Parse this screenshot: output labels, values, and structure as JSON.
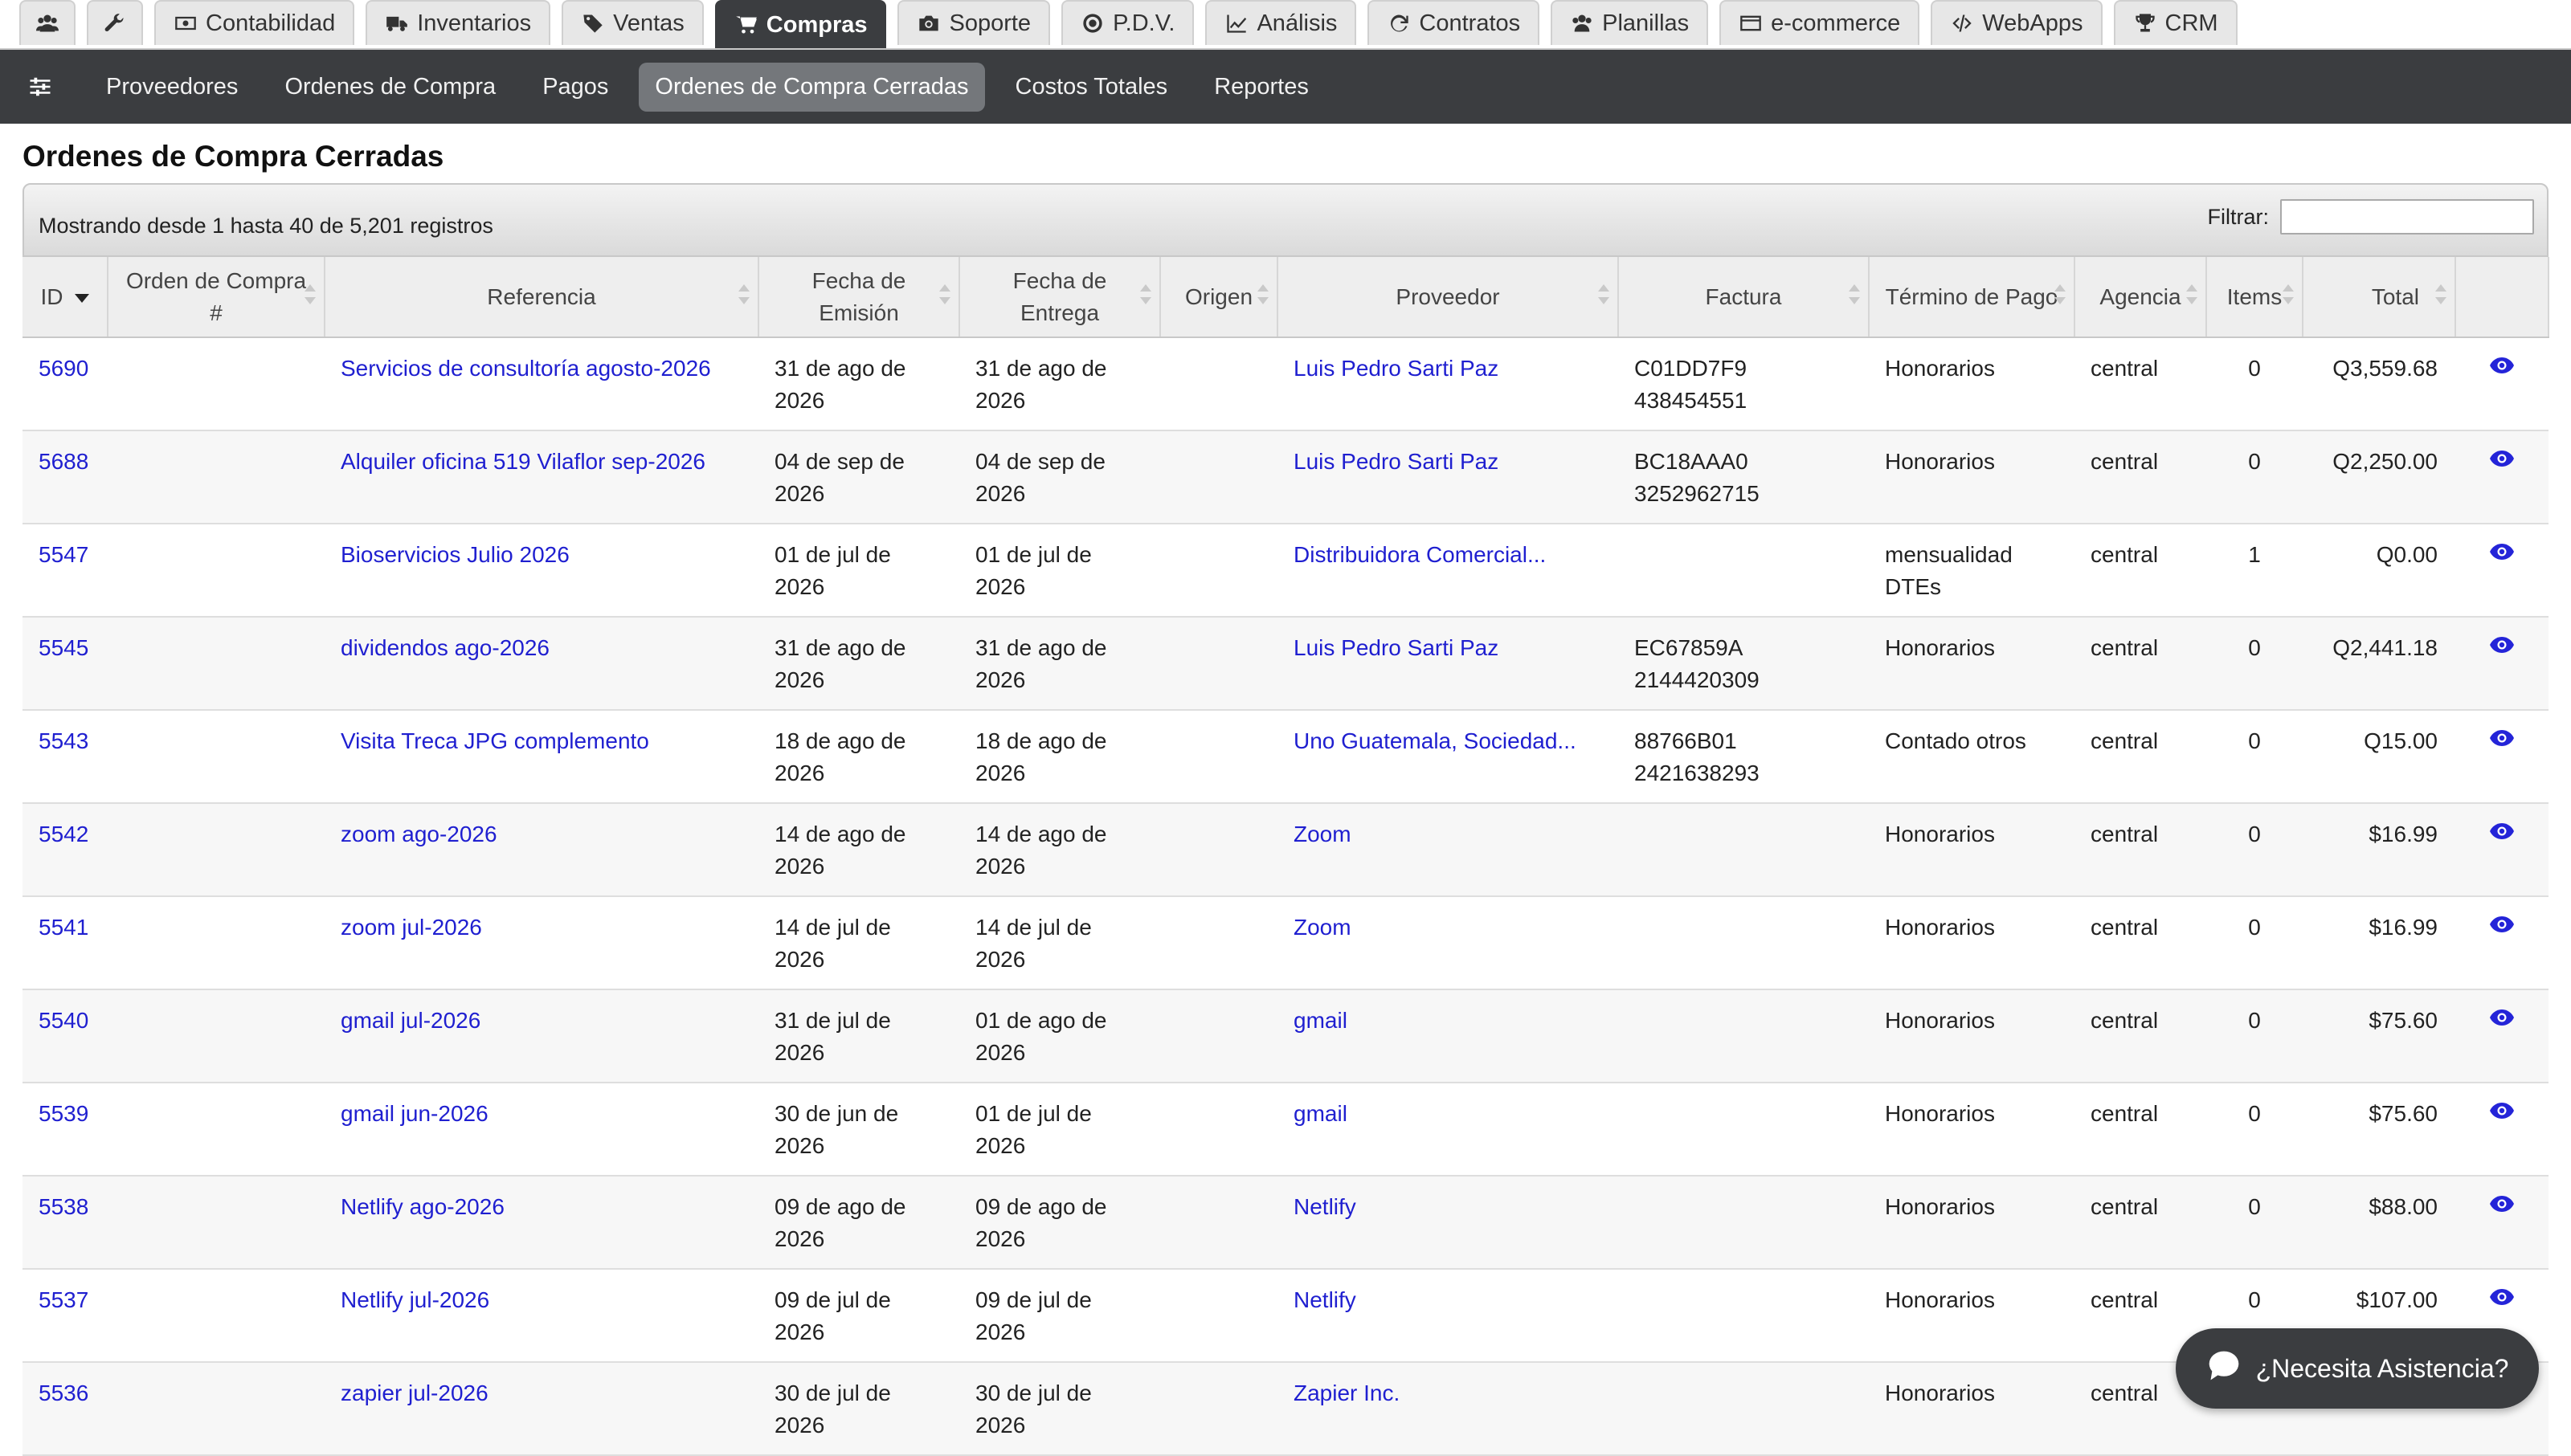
{
  "modules": [
    {
      "label": "",
      "icon": "users-icon"
    },
    {
      "label": "",
      "icon": "wrench-icon"
    },
    {
      "label": "Contabilidad",
      "icon": "money-icon"
    },
    {
      "label": "Inventarios",
      "icon": "truck-icon"
    },
    {
      "label": "Ventas",
      "icon": "tag-icon"
    },
    {
      "label": "Compras",
      "icon": "cart-icon",
      "active": true
    },
    {
      "label": "Soporte",
      "icon": "camera-icon"
    },
    {
      "label": "P.D.V.",
      "icon": "target-icon"
    },
    {
      "label": "Análisis",
      "icon": "chart-icon"
    },
    {
      "label": "Contratos",
      "icon": "refresh-icon"
    },
    {
      "label": "Planillas",
      "icon": "group-icon"
    },
    {
      "label": "e-commerce",
      "icon": "card-icon"
    },
    {
      "label": "WebApps",
      "icon": "code-icon"
    },
    {
      "label": "CRM",
      "icon": "trophy-icon"
    }
  ],
  "subnav": {
    "items": [
      "Proveedores",
      "Ordenes de Compra",
      "Pagos",
      "Ordenes de Compra Cerradas",
      "Costos Totales",
      "Reportes"
    ],
    "active_index": 3
  },
  "page": {
    "title": "Ordenes de Compra Cerradas"
  },
  "table_info": {
    "showing": "Mostrando desde 1 hasta 40 de 5,201 registros",
    "filter_label": "Filtrar:",
    "filter_value": ""
  },
  "columns": {
    "id": "ID",
    "orden": "Orden de Compra #",
    "referencia": "Referencia",
    "emision": "Fecha de Emisión",
    "entrega": "Fecha de Entrega",
    "origen": "Origen",
    "proveedor": "Proveedor",
    "factura": "Factura",
    "termino": "Término de Pago",
    "agencia": "Agencia",
    "items": "Items",
    "total": "Total"
  },
  "rows": [
    {
      "id": "5690",
      "orden": "",
      "referencia": "Servicios de consultoría agosto-2026",
      "emision": "31 de ago de 2026",
      "entrega": "31 de ago de 2026",
      "origen": "",
      "proveedor": "Luis Pedro Sarti Paz",
      "factura": "C01DD7F9 438454551",
      "termino": "Honorarios",
      "agencia": "central",
      "items": "0",
      "total": "Q3,559.68"
    },
    {
      "id": "5688",
      "orden": "",
      "referencia": "Alquiler oficina 519 Vilaflor sep-2026",
      "emision": "04 de sep de 2026",
      "entrega": "04 de sep de 2026",
      "origen": "",
      "proveedor": "Luis Pedro Sarti Paz",
      "factura": "BC18AAA0 3252962715",
      "termino": "Honorarios",
      "agencia": "central",
      "items": "0",
      "total": "Q2,250.00"
    },
    {
      "id": "5547",
      "orden": "",
      "referencia": "Bioservicios Julio 2026",
      "emision": "01 de jul de 2026",
      "entrega": "01 de jul de 2026",
      "origen": "",
      "proveedor": "Distribuidora Comercial...",
      "factura": "",
      "termino": "mensualidad DTEs",
      "agencia": "central",
      "items": "1",
      "total": "Q0.00"
    },
    {
      "id": "5545",
      "orden": "",
      "referencia": "dividendos ago-2026",
      "emision": "31 de ago de 2026",
      "entrega": "31 de ago de 2026",
      "origen": "",
      "proveedor": "Luis Pedro Sarti Paz",
      "factura": "EC67859A 2144420309",
      "termino": "Honorarios",
      "agencia": "central",
      "items": "0",
      "total": "Q2,441.18"
    },
    {
      "id": "5543",
      "orden": "",
      "referencia": "Visita Treca JPG complemento",
      "emision": "18 de ago de 2026",
      "entrega": "18 de ago de 2026",
      "origen": "",
      "proveedor": "Uno Guatemala, Sociedad...",
      "factura": "88766B01 2421638293",
      "termino": "Contado otros",
      "agencia": "central",
      "items": "0",
      "total": "Q15.00"
    },
    {
      "id": "5542",
      "orden": "",
      "referencia": "zoom ago-2026",
      "emision": "14 de ago de 2026",
      "entrega": "14 de ago de 2026",
      "origen": "",
      "proveedor": "Zoom",
      "factura": "",
      "termino": "Honorarios",
      "agencia": "central",
      "items": "0",
      "total": "$16.99"
    },
    {
      "id": "5541",
      "orden": "",
      "referencia": "zoom jul-2026",
      "emision": "14 de jul de 2026",
      "entrega": "14 de jul de 2026",
      "origen": "",
      "proveedor": "Zoom",
      "factura": "",
      "termino": "Honorarios",
      "agencia": "central",
      "items": "0",
      "total": "$16.99"
    },
    {
      "id": "5540",
      "orden": "",
      "referencia": "gmail jul-2026",
      "emision": "31 de jul de 2026",
      "entrega": "01 de ago de 2026",
      "origen": "",
      "proveedor": "gmail",
      "factura": "",
      "termino": "Honorarios",
      "agencia": "central",
      "items": "0",
      "total": "$75.60"
    },
    {
      "id": "5539",
      "orden": "",
      "referencia": "gmail jun-2026",
      "emision": "30 de jun de 2026",
      "entrega": "01 de jul de 2026",
      "origen": "",
      "proveedor": "gmail",
      "factura": "",
      "termino": "Honorarios",
      "agencia": "central",
      "items": "0",
      "total": "$75.60"
    },
    {
      "id": "5538",
      "orden": "",
      "referencia": "Netlify ago-2026",
      "emision": "09 de ago de 2026",
      "entrega": "09 de ago de 2026",
      "origen": "",
      "proveedor": "Netlify",
      "factura": "",
      "termino": "Honorarios",
      "agencia": "central",
      "items": "0",
      "total": "$88.00"
    },
    {
      "id": "5537",
      "orden": "",
      "referencia": "Netlify jul-2026",
      "emision": "09 de jul de 2026",
      "entrega": "09 de jul de 2026",
      "origen": "",
      "proveedor": "Netlify",
      "factura": "",
      "termino": "Honorarios",
      "agencia": "central",
      "items": "0",
      "total": "$107.00"
    },
    {
      "id": "5536",
      "orden": "",
      "referencia": "zapier jul-2026",
      "emision": "30 de jul de 2026",
      "entrega": "30 de jul de 2026",
      "origen": "",
      "proveedor": "Zapier Inc.",
      "factura": "",
      "termino": "Honorarios",
      "agencia": "central",
      "items": "0",
      "total": ""
    }
  ],
  "assist": {
    "label": "¿Necesita Asistencia?",
    "icon": "chat-bubble-icon"
  },
  "colors": {
    "nav_dark": "#3b3d40",
    "link": "#1f1fd0",
    "active_sub": "#74777b"
  }
}
